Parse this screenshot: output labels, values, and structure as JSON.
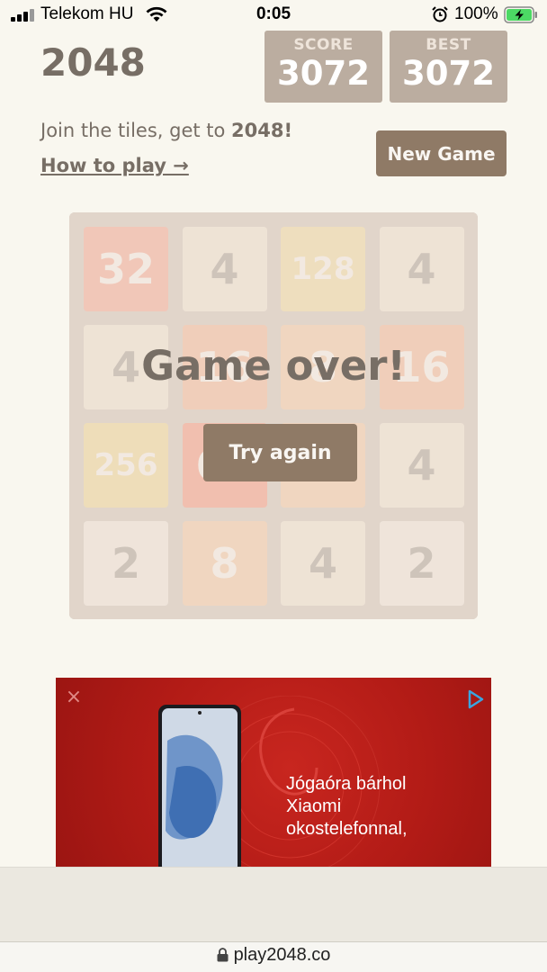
{
  "status_bar": {
    "carrier": "Telekom HU",
    "time": "0:05",
    "battery": "100%"
  },
  "header": {
    "logo": "2048",
    "score_label": "SCORE",
    "score_value": "3072",
    "best_label": "BEST",
    "best_value": "3072",
    "intro_prefix": "Join the tiles, get to ",
    "intro_bold": "2048!",
    "how_to_play": "How to play →",
    "new_game": "New Game"
  },
  "board": {
    "rows": [
      [
        "32",
        "4",
        "128",
        "4"
      ],
      [
        "4",
        "16",
        "8",
        "16"
      ],
      [
        "256",
        "64",
        "8",
        "4"
      ],
      [
        "2",
        "8",
        "4",
        "2"
      ]
    ],
    "colors": {
      "board_bg": "#bbada0",
      "tile_2": "#eee4da",
      "tile_4": "#ede0c8",
      "tile_8": "#f2b179",
      "tile_16": "#f59563",
      "tile_32": "#f67c5f",
      "tile_64": "#f65e3b",
      "tile_128": "#edcf72",
      "tile_256": "#edcc61"
    }
  },
  "game_over": {
    "message": "Game over!",
    "try_again": "Try again"
  },
  "ad": {
    "close_icon": "close-icon",
    "choice_icon": "ad-choices-icon",
    "lines": [
      "Jógaóra bárhol",
      "Xiaomi",
      "okostelefonnal,"
    ]
  },
  "browser": {
    "url": "play2048.co"
  }
}
